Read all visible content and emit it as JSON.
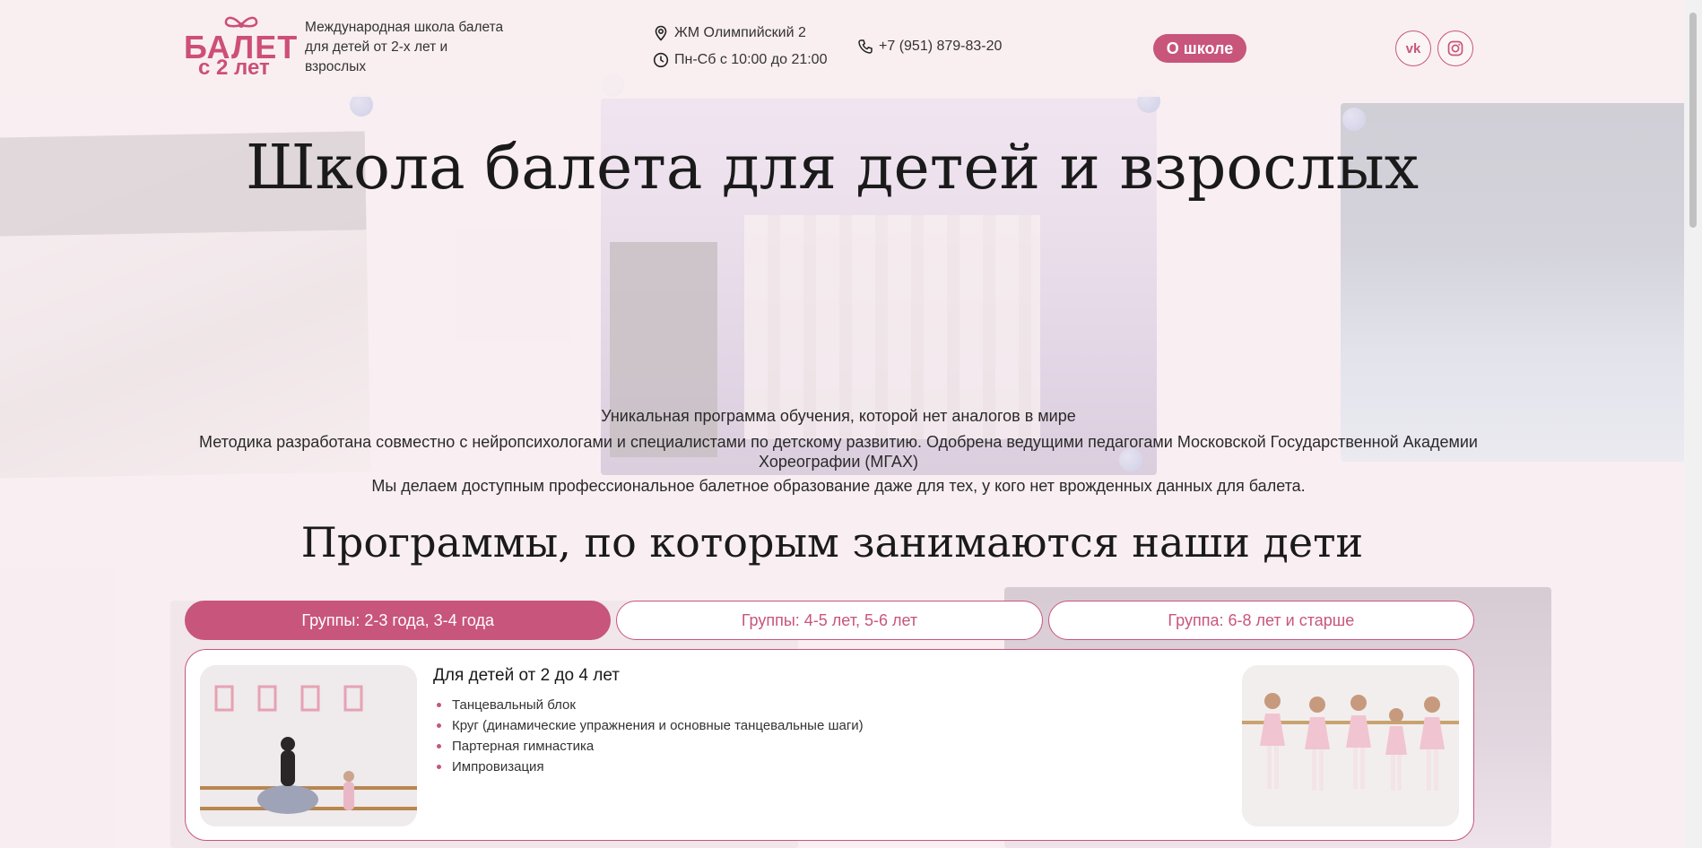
{
  "brand": {
    "logo_line1": "БАЛЕТ",
    "logo_line2": "с 2 лет",
    "tagline": "Международная школа балета для детей от 2-х лет и взрослых",
    "accent_color": "#c8557c"
  },
  "header": {
    "address": "ЖМ Олимпийский 2",
    "hours": "Пн-Сб с 10:00 до 21:00",
    "phone": "+7 (951) 879-83-20",
    "about_button": "О школе",
    "social": [
      {
        "label": "VK",
        "icon": "vk-icon"
      },
      {
        "label": "Instagram",
        "icon": "instagram-icon"
      }
    ]
  },
  "hero": {
    "title": "Школа балета для детей и взрослых",
    "line1": "Уникальная программа обучения, которой нет аналогов в мире",
    "line2": "Методика разработана совместно с нейропсихологами и специалистами по детскому развитию. Одобрена ведущими педагогами Московской Государственной Академии Хореографии (МГАХ)",
    "line3": "Мы делаем доступным профессиональное балетное образование даже для тех, у кого нет врожденных данных для балета."
  },
  "programs": {
    "title": "Программы, по которым занимаются наши дети",
    "tabs": [
      {
        "label": "Группы: 2-3 года, 3-4 года",
        "active": true
      },
      {
        "label": "Группы: 4-5 лет, 5-6 лет",
        "active": false
      },
      {
        "label": "Группа: 6-8 лет и старше",
        "active": false
      }
    ],
    "card": {
      "heading": "Для детей от 2 до 4 лет",
      "items": [
        "Танцевальный блок",
        "Круг (динамические упражнения и основные танцевальные шаги)",
        "Партерная гимнастика",
        "Импровизация"
      ]
    }
  }
}
